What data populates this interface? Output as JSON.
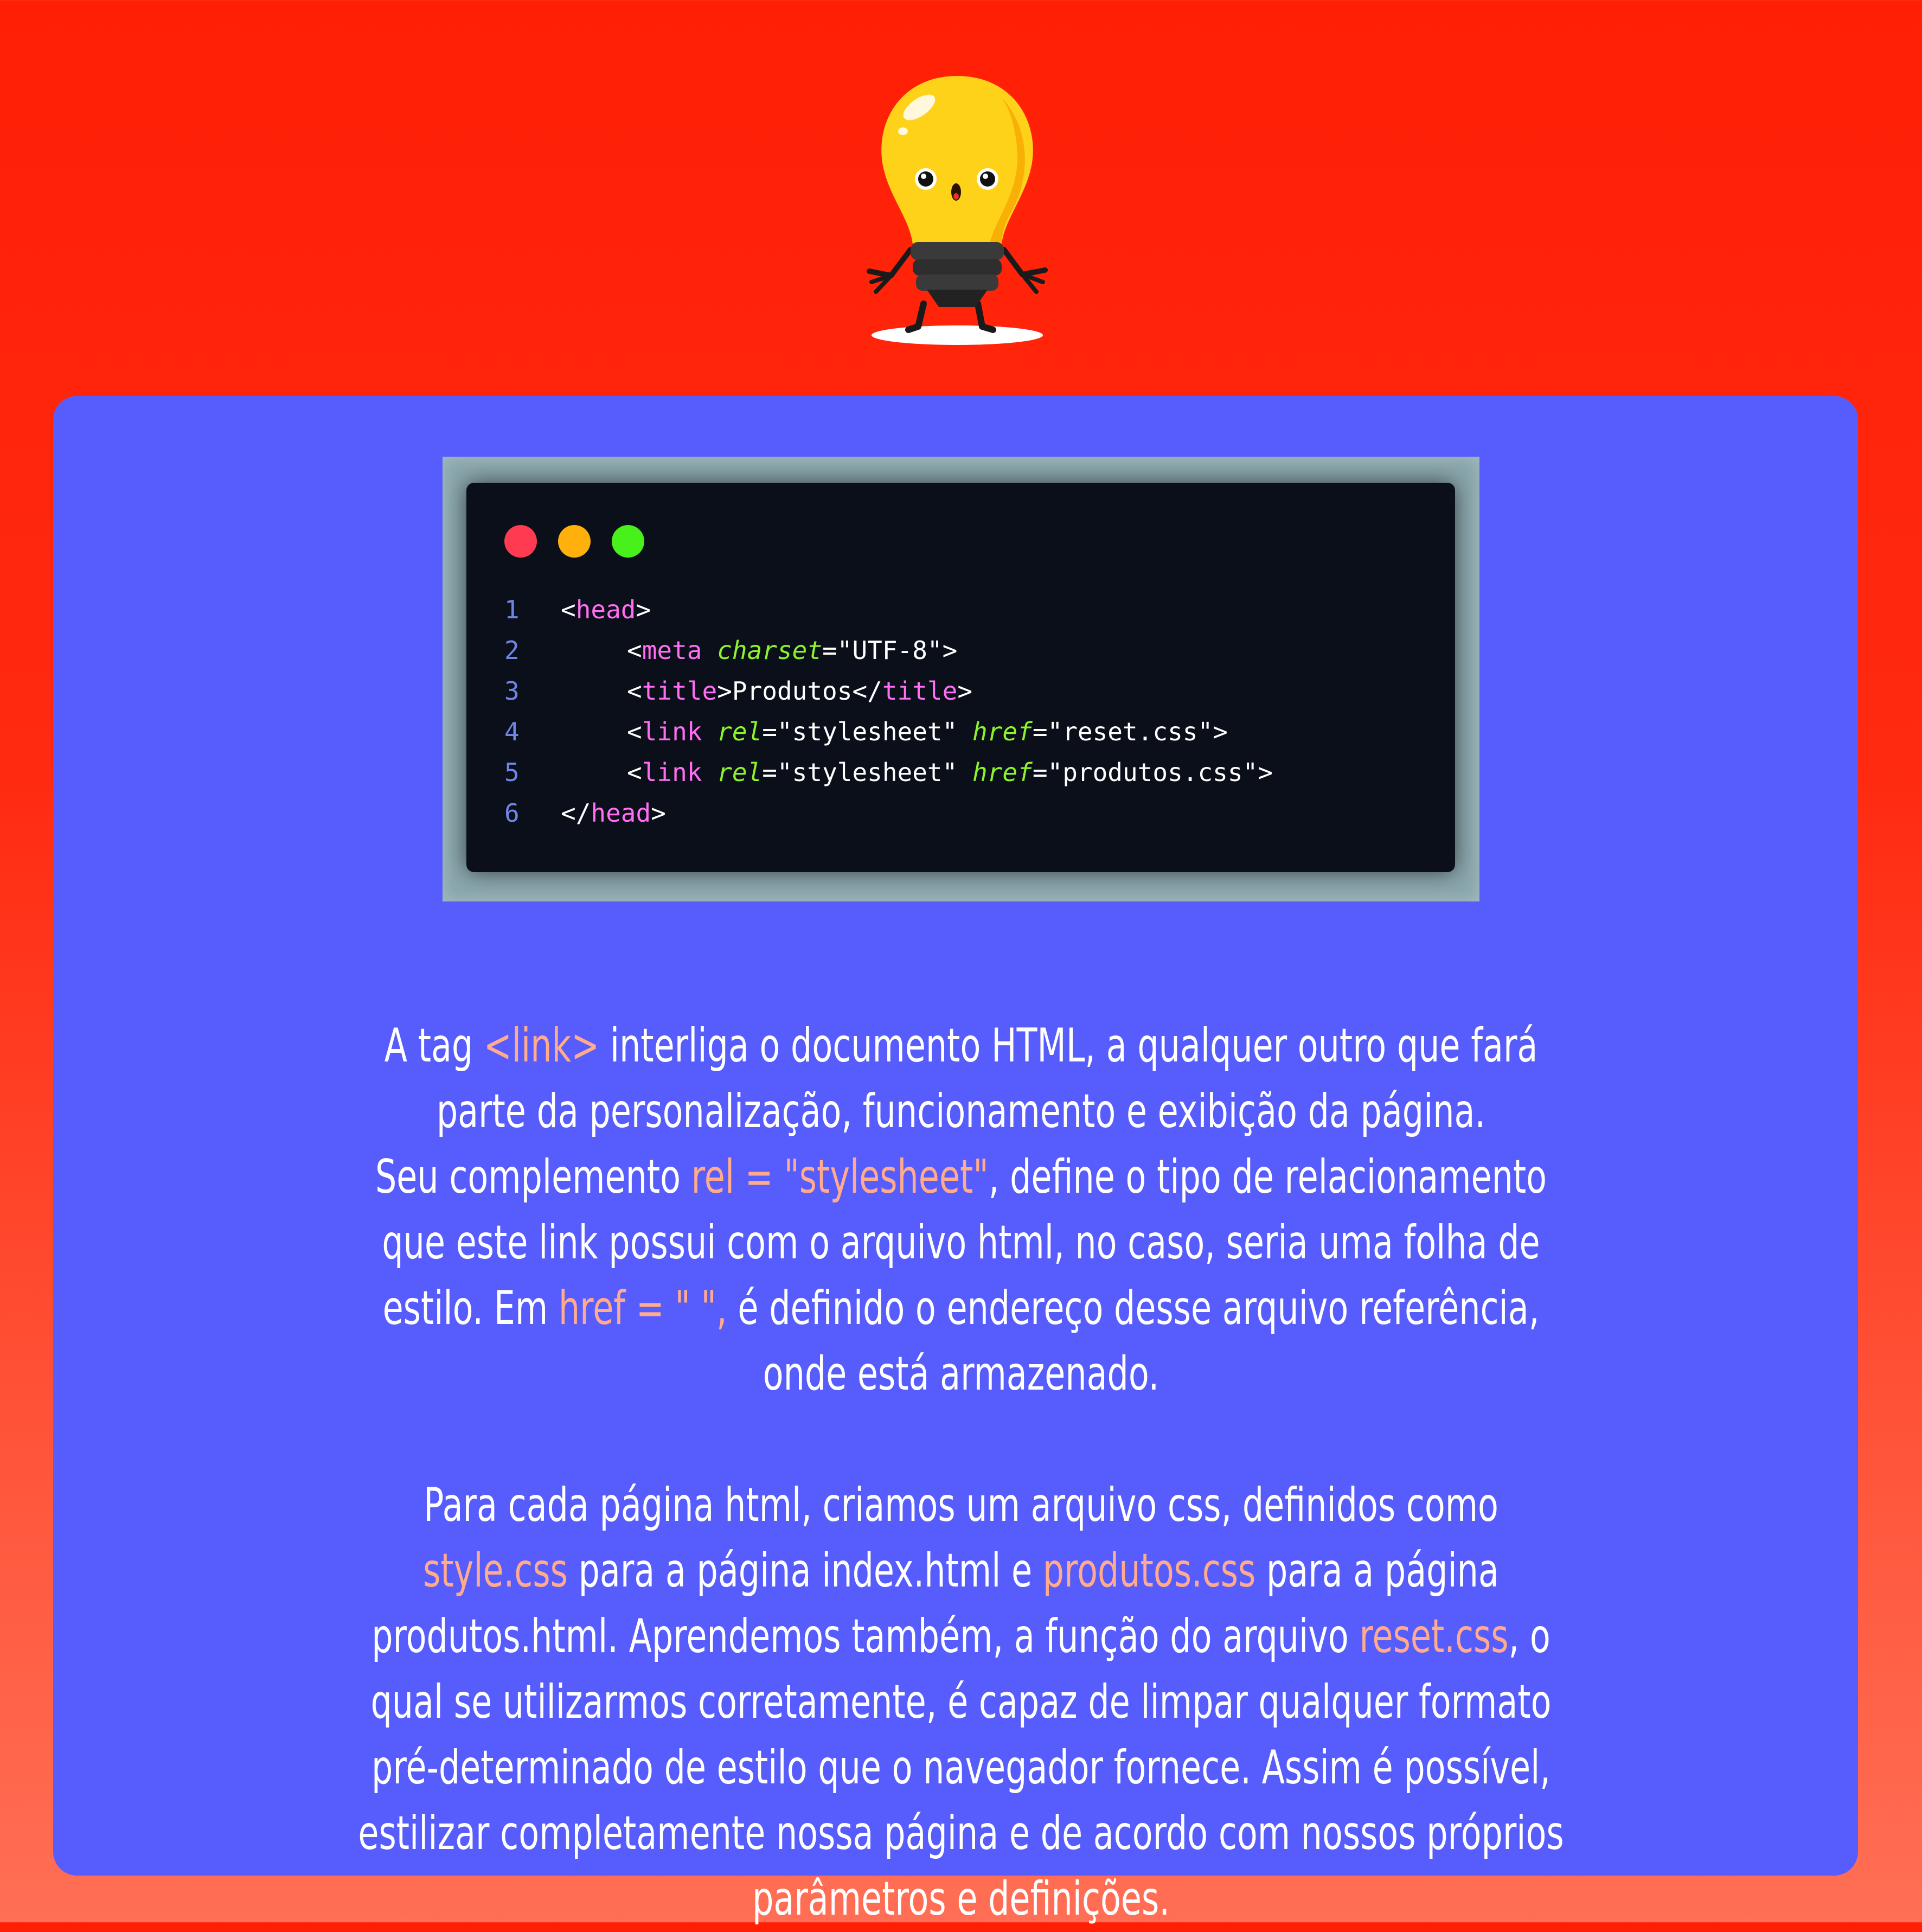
{
  "colors": {
    "background_top": "#ff1f05",
    "background_bottom": "#ff6f55",
    "panel": "#575dfd",
    "code_frame": "#8aa7ad",
    "code_background": "#0b0f1a",
    "highlight_text": "#ffab8c",
    "code_tag": "#ff6ef3",
    "code_attribute": "#8df32a",
    "line_number": "#6f86e6"
  },
  "mascot": {
    "icon": "lightbulb-mascot-icon"
  },
  "code_window": {
    "window_dots": [
      "#ff3a51",
      "#ffb00a",
      "#48f11a"
    ],
    "lines": [
      {
        "number": "1",
        "lt": "<",
        "tag": "head",
        "gt": ">"
      },
      {
        "number": "2",
        "lt": "<",
        "tag": "meta",
        "space": " ",
        "attr1": "charset",
        "eq1": "=",
        "val1": "\"UTF-8\"",
        "gt": ">"
      },
      {
        "number": "3",
        "lt": "<",
        "tag": "title",
        "gt": ">",
        "text": "Produtos",
        "close_lt": "</",
        "close_tag": "title",
        "close_gt": ">"
      },
      {
        "number": "4",
        "lt": "<",
        "tag": "link",
        "space": " ",
        "attr1": "rel",
        "eq1": "=",
        "val1": "\"stylesheet\"",
        "space2": " ",
        "attr2": "href",
        "eq2": "=",
        "val2": "\"reset.css\"",
        "gt": ">"
      },
      {
        "number": "5",
        "lt": "<",
        "tag": "link",
        "space": " ",
        "attr1": "rel",
        "eq1": "=",
        "val1": "\"stylesheet\"",
        "space2": " ",
        "attr2": "href",
        "eq2": "=",
        "val2": "\"produtos.css\"",
        "gt": ">"
      },
      {
        "number": "6",
        "lt": "</",
        "tag": "head",
        "gt": ">"
      }
    ]
  },
  "description": {
    "p1": {
      "t1": "A tag ",
      "h1": "<link>",
      "t2": " interliga o documento HTML, a qualquer outro que fará parte da personalização, funcionamento e exibição da página."
    },
    "p2": {
      "t1": "Seu complemento ",
      "h1": "rel = \"stylesheet\"",
      "t2": ", define o tipo de relacionamento que este link possui com o arquivo html, no caso, seria uma folha de estilo. Em  ",
      "h2": "href = \" \",",
      "t3": " é definido o endereço desse arquivo referência, onde está armazenado."
    },
    "p3": {
      "t1": "Para cada página html, criamos um arquivo css, definidos como ",
      "h1": "style.css",
      "t2": " para a página index.html e ",
      "h2": "produtos.css",
      "t3": " para a página produtos.html. Aprendemos também, a função do arquivo ",
      "h3": "reset.css",
      "t4": ", o qual se utilizarmos corretamente, é capaz de limpar qualquer formato pré-determinado de estilo que o navegador fornece. Assim é possível, estilizar completamente nossa página e de acordo com nossos próprios parâmetros e definições."
    }
  }
}
